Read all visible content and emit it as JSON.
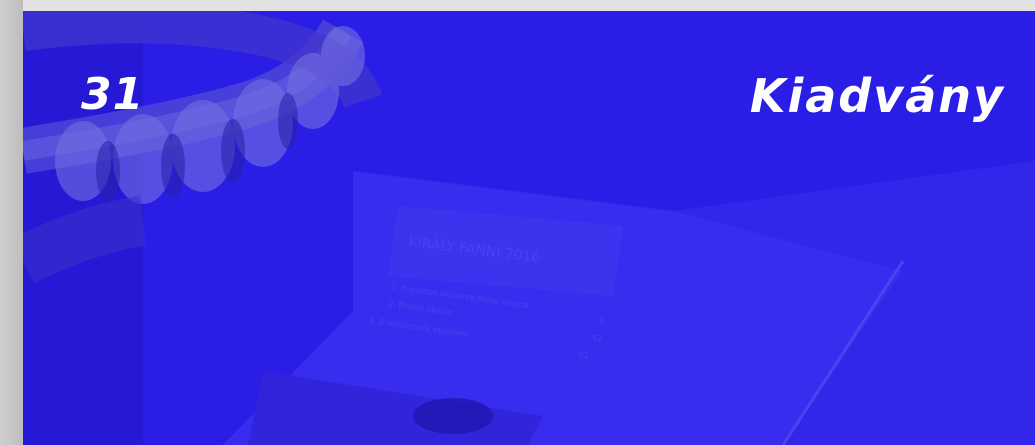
{
  "page": {
    "number": "31",
    "title": "Kiadvány"
  },
  "colors": {
    "background": "#2a1ee6",
    "text": "#ffffff"
  },
  "photo": {
    "book_heading": "KIRÁLY FANNI 2016",
    "toc": [
      {
        "label": "1. Pogumos ékszerek/Neke sorozat",
        "page": "3"
      },
      {
        "label": "2. Monok ékszer",
        "page": "43"
      },
      {
        "label": "3. Ø fémtermék ékszerek",
        "page": "51"
      }
    ]
  }
}
